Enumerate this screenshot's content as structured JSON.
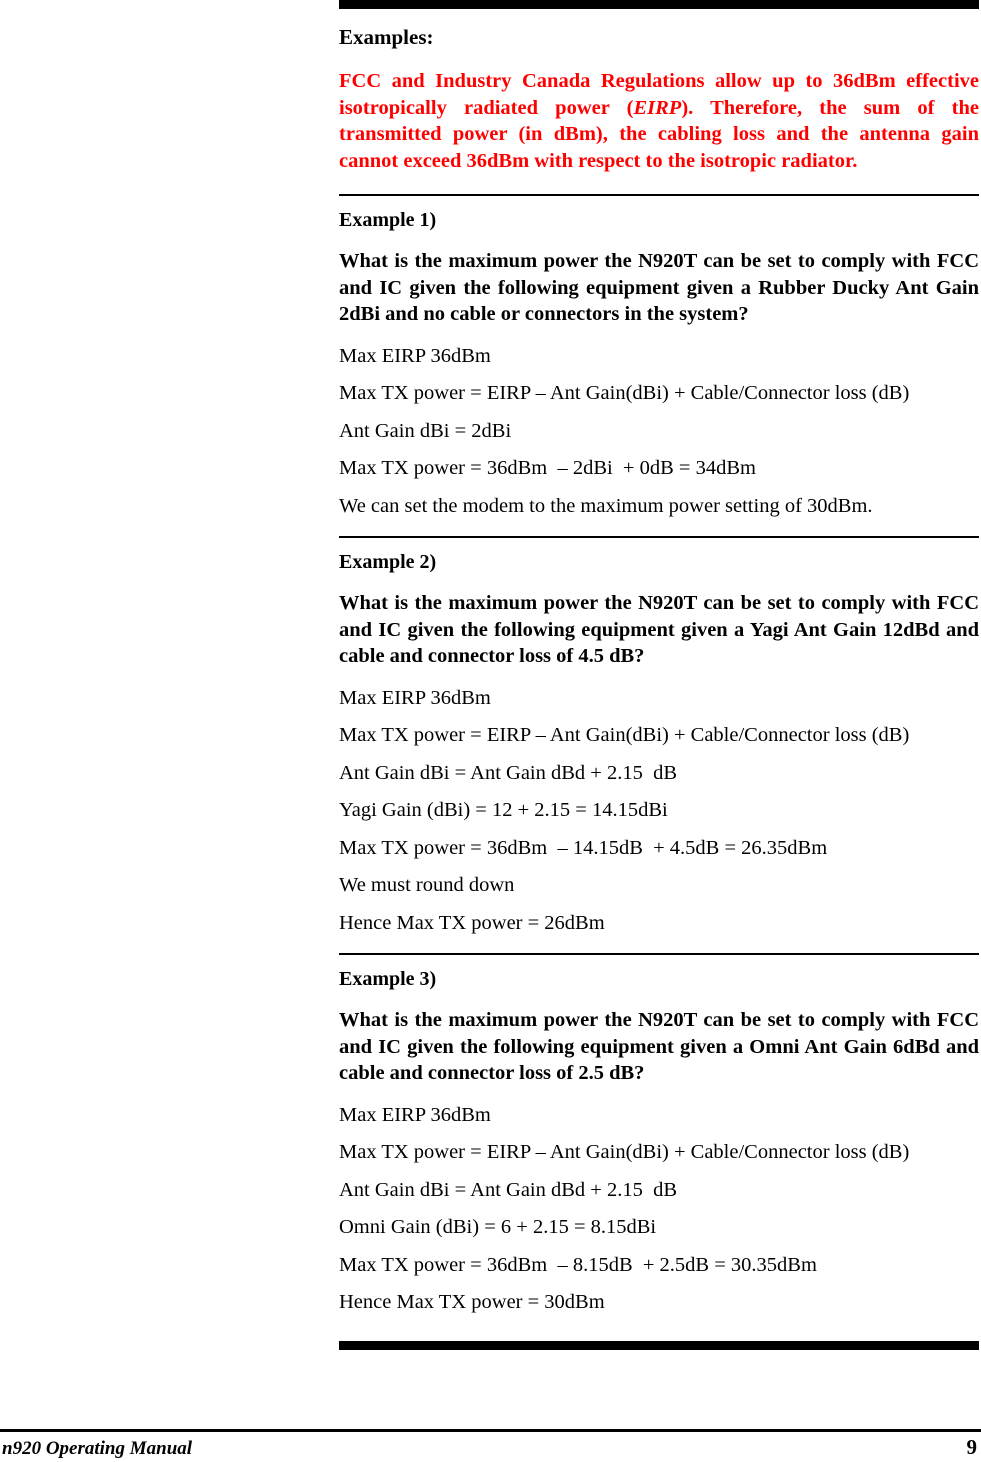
{
  "document": {
    "section_heading": "Examples:",
    "warning": {
      "part1": "FCC and Industry Canada Regulations allow up to 36dBm effective isotropically radiated power (",
      "emphasis": "EIRP",
      "part2": ").  Therefore, the sum of the transmitted power (in dBm), the cabling loss and the antenna gain cannot exceed 36dBm with respect to the isotropic radiator.",
      "color": "#FF0000"
    },
    "examples": [
      {
        "title": "Example 1)",
        "question": "What is the maximum power the N920T can be set to comply with FCC and IC given the following equipment given a Rubber Ducky Ant Gain 2dBi and no cable or connectors in the system?",
        "lines": [
          "Max EIRP 36dBm",
          "Max TX power = EIRP – Ant Gain(dBi) + Cable/Connector loss (dB)",
          "Ant Gain dBi = 2dBi",
          "Max TX power = 36dBm  – 2dBi  + 0dB = 34dBm",
          "We can set the modem to the maximum power setting of 30dBm."
        ]
      },
      {
        "title": "Example 2)",
        "question": "What is the maximum power the N920T can be set to comply with FCC and IC given the following equipment given a Yagi Ant Gain 12dBd and cable and connector loss of 4.5 dB?",
        "lines": [
          "Max EIRP 36dBm",
          "Max TX power = EIRP – Ant Gain(dBi) + Cable/Connector loss (dB)",
          "Ant Gain dBi = Ant Gain dBd + 2.15  dB",
          "Yagi Gain (dBi) = 12 + 2.15 = 14.15dBi",
          "Max TX power = 36dBm  – 14.15dB  + 4.5dB = 26.35dBm",
          "We must round down",
          "Hence Max TX power = 26dBm"
        ]
      },
      {
        "title": "Example 3)",
        "question": "What is the maximum power the N920T can be set to comply with FCC and IC given the following equipment given a Omni Ant Gain 6dBd and cable and connector loss of 2.5 dB?",
        "lines": [
          "Max EIRP 36dBm",
          "Max TX power = EIRP – Ant Gain(dBi) + Cable/Connector loss (dB)",
          "Ant Gain dBi = Ant Gain dBd + 2.15  dB",
          "Omni Gain (dBi) = 6 + 2.15 = 8.15dBi",
          "Max TX power = 36dBm  – 8.15dB  + 2.5dB = 30.35dBm",
          "Hence Max TX power = 30dBm"
        ]
      }
    ],
    "footer": {
      "left": "n920 Operating Manual",
      "page_number": "9"
    }
  }
}
